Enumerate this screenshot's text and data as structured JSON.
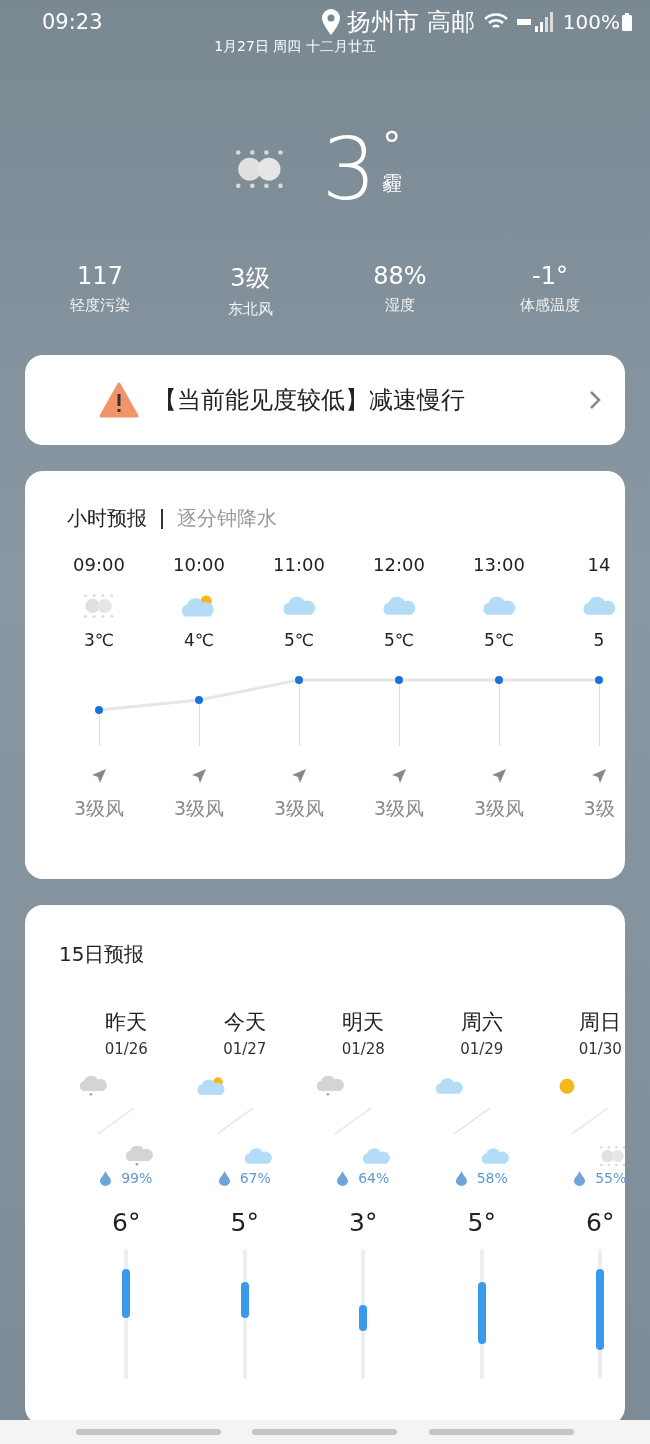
{
  "status_bar": {
    "time": "09:23",
    "battery": "100%"
  },
  "location": "扬州市 高邮",
  "date": "1月27日 周四 十二月廿五",
  "current": {
    "kind": "haze",
    "temperature": "3",
    "degree": "°",
    "condition": "霾"
  },
  "stats": [
    {
      "value": "117",
      "label": "轻度污染"
    },
    {
      "value": "3级",
      "label": "东北风"
    },
    {
      "value": "88%",
      "label": "湿度"
    },
    {
      "value": "-1°",
      "label": "体感温度"
    }
  ],
  "alert": {
    "text": "【当前能见度较低】减速慢行"
  },
  "hourly": {
    "tabs": [
      {
        "label": "小时预报",
        "selected": true
      },
      {
        "label": "逐分钟降水",
        "selected": false
      }
    ],
    "hours": [
      {
        "time": "09:00",
        "kind": "haze",
        "temp": "3℃",
        "wind": "3级风"
      },
      {
        "time": "10:00",
        "kind": "partly_cloudy",
        "temp": "4℃",
        "wind": "3级风"
      },
      {
        "time": "11:00",
        "kind": "cloud",
        "temp": "5℃",
        "wind": "3级风"
      },
      {
        "time": "12:00",
        "kind": "cloud",
        "temp": "5℃",
        "wind": "3级风"
      },
      {
        "time": "13:00",
        "kind": "cloud",
        "temp": "5℃",
        "wind": "3级风"
      },
      {
        "time": "14",
        "kind": "cloud",
        "temp": "5",
        "wind": "3级"
      }
    ]
  },
  "daily": {
    "title": "15日预报",
    "days": [
      {
        "name": "昨天",
        "date": "01/26",
        "day": {
          "kind": "rain_cloud"
        },
        "night": {
          "kind": "rain_cloud"
        },
        "rain": "99%",
        "high": "6°"
      },
      {
        "name": "今天",
        "date": "01/27",
        "day": {
          "kind": "partly_cloudy"
        },
        "night": {
          "kind": "cloud"
        },
        "rain": "67%",
        "high": "5°"
      },
      {
        "name": "明天",
        "date": "01/28",
        "day": {
          "kind": "rain_cloud"
        },
        "night": {
          "kind": "cloud"
        },
        "rain": "64%",
        "high": "3°"
      },
      {
        "name": "周六",
        "date": "01/29",
        "day": {
          "kind": "cloud"
        },
        "night": {
          "kind": "cloud"
        },
        "rain": "58%",
        "high": "5°"
      },
      {
        "name": "周日",
        "date": "01/30",
        "day": {
          "kind": "sun"
        },
        "night": {
          "kind": "haze"
        },
        "rain": "55%",
        "high": "6°"
      }
    ]
  }
}
